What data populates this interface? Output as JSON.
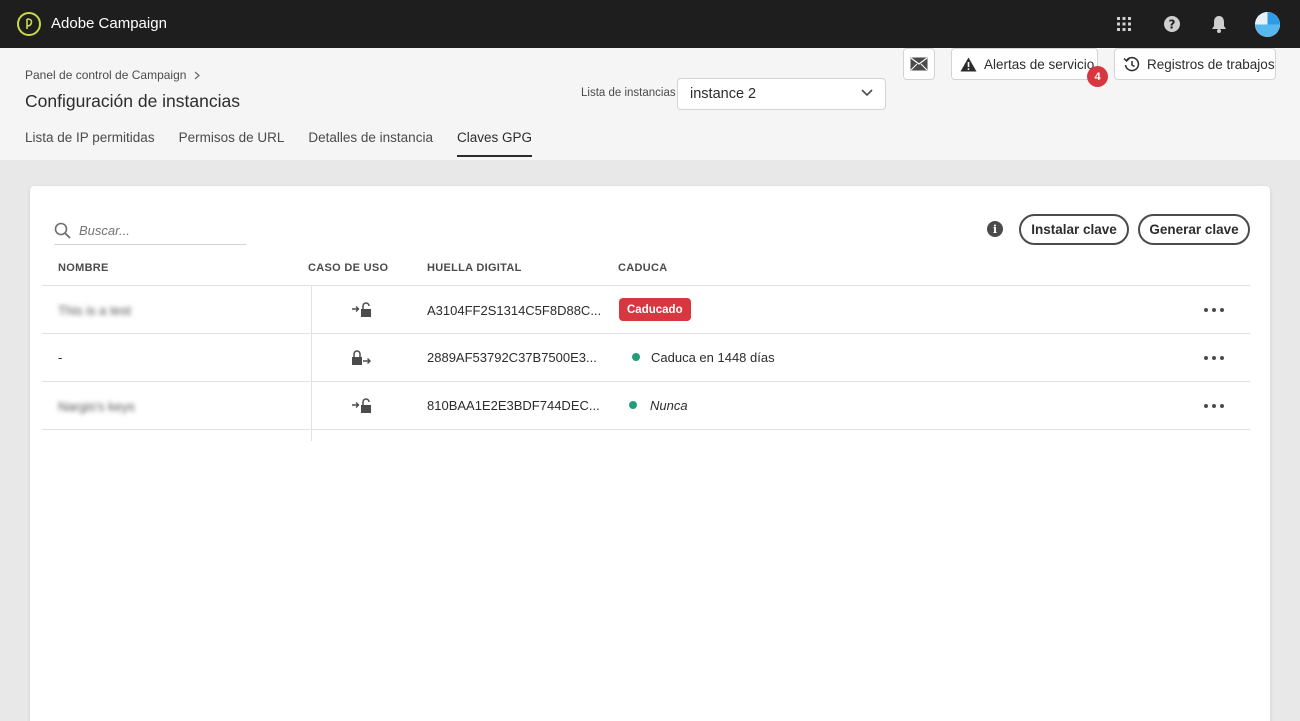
{
  "app": {
    "title": "Adobe Campaign"
  },
  "topbar": {
    "icons": [
      "apps-grid-icon",
      "help-icon",
      "notifications-bell-icon",
      "user-avatar"
    ]
  },
  "header": {
    "breadcrumb": "Panel de control de Campaign",
    "title": "Configuración de instancias",
    "instance_label": "Lista de instancias",
    "instance_selected": "instance 2",
    "service_alerts_label": "Alertas de servicio",
    "service_alerts_count": "4",
    "job_logs_label": "Registros de trabajos",
    "tabs": [
      {
        "label": "Lista de IP permitidas",
        "active": false
      },
      {
        "label": "Permisos de URL",
        "active": false
      },
      {
        "label": "Detalles de instancia",
        "active": false
      },
      {
        "label": "Claves GPG",
        "active": true
      }
    ]
  },
  "toolbar": {
    "search_placeholder": "Buscar...",
    "install_key_label": "Instalar clave",
    "generate_key_label": "Generar clave"
  },
  "table": {
    "columns": [
      "NOMBRE",
      "CASO DE USO",
      "HUELLA DIGITAL",
      "CADUCA"
    ],
    "rows": [
      {
        "name": "This is a test",
        "name_blurred": true,
        "use_case_icon": "decrypt-icon",
        "fingerprint": "A3104FF2S1314C5F8D88C...",
        "expiry": "Caducado",
        "expiry_type": "expired"
      },
      {
        "name": "-",
        "name_blurred": false,
        "use_case_icon": "encrypt-icon",
        "fingerprint": "2889AF53792C37B7500E3...",
        "expiry": "Caduca en 1448 días",
        "expiry_type": "active"
      },
      {
        "name": "Nargis's keys",
        "name_blurred": true,
        "use_case_icon": "decrypt-icon",
        "fingerprint": "810BAA1E2E3BDF744DEC...",
        "expiry": "Nunca",
        "expiry_type": "never"
      }
    ]
  },
  "colors": {
    "topbar_bg": "#1e1e1e",
    "expired_red": "#d7373f",
    "active_green": "#1f9f79",
    "logo_accent": "#c8d94b"
  }
}
